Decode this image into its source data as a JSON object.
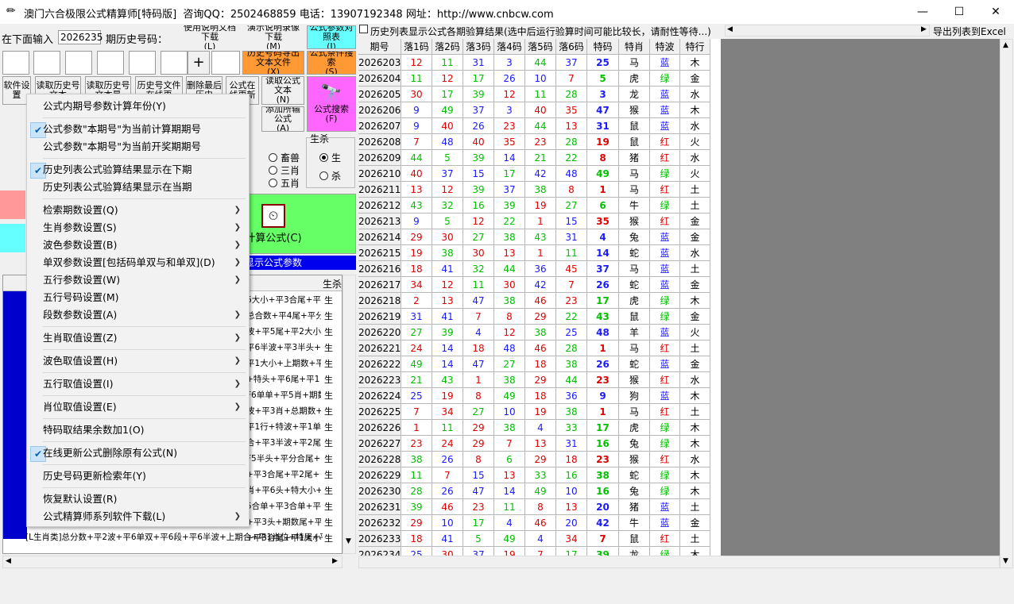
{
  "window": {
    "title": "澳门六合极限公式精算师[特码版]  咨询QQ：2502468859 电话：13907192348 网址：http://www.cnbcw.com",
    "minimize": "—",
    "maximize": "☐",
    "close": "✕"
  },
  "top": {
    "input_label": "在下面输入",
    "issue_value": "2026235",
    "history_label": "期历史号码：",
    "btn_manual": "使用说明文档下载",
    "btn_manual_key": "(L)",
    "btn_video": "演示说明录像下载",
    "btn_video_key": "(M)",
    "btn_params": "公式参数对照表",
    "btn_params_key": "(I)",
    "plus": "+"
  },
  "left_buttons": {
    "export_history": "历史号码导出文本文件",
    "export_history_key": "(X)",
    "condition_search": "公式条件搜索",
    "condition_search_key": "(S)",
    "read_formula": "读取公式文本",
    "read_formula_key": "(N)",
    "add_all": "添加所输公式",
    "add_all_key": "(A)",
    "formula_search": "公式搜索",
    "formula_search_key": "(F)",
    "calc_formula": "计算公式",
    "calc_formula_key": "(C)",
    "show_params": "显示公式参数",
    "row2": [
      "软件设置",
      "读取历史号文本",
      "读取历史号文本最",
      "历史号文件在线更",
      "删除最后历史",
      "公式在线更新"
    ]
  },
  "options": {
    "group_label": "生杀",
    "sheng": "生",
    "sha": "杀",
    "chusheng": "畜兽",
    "sanxiao": "三肖",
    "wuxiao": "五肖",
    "col_header": "生杀"
  },
  "formula_rows": [
    {
      "text": "6大小+平3合尾+平4",
      "s": "生"
    },
    {
      "text": "总合数+平4尾+平分",
      "s": "生"
    },
    {
      "text": "波+平5尾+平2大小",
      "s": "生"
    },
    {
      "text": "平6半波+平3半头+5",
      "s": "生"
    },
    {
      "text": "平1大小+上期数+平",
      "s": "生"
    },
    {
      "text": "+特头+平6尾+平1",
      "s": "生"
    },
    {
      "text": "F6单单+平5肖+期数",
      "s": "生"
    },
    {
      "text": "波+平3肖+总期数+",
      "s": "生"
    },
    {
      "text": "平1行+特波+平1单",
      "s": "生"
    },
    {
      "text": "合+平3半波+平2尾+",
      "s": "生"
    },
    {
      "text": "F5半头+平分合尾+平",
      "s": "生"
    },
    {
      "text": "+平3合尾+平2尾+",
      "s": "生"
    },
    {
      "text": "肖+平6头+特大小+",
      "s": "生"
    },
    {
      "text": "5合单+平3合单+平",
      "s": "生"
    },
    {
      "text": "+平3头+期数尾+平2",
      "s": "生"
    },
    {
      "text": "+平3合尾+平1大小",
      "s": "生"
    }
  ],
  "bottom_formula": "[L生肖类]总分数+平2波+平6单双+平6段+平6半波+上期合+平1肖位+特尾+平3合",
  "context_menu": [
    {
      "label": "公式内期号参数计算年份(Y)",
      "check": false,
      "sub": false,
      "sep_after": true
    },
    {
      "label": "公式参数\"本期号\"为当前计算期期号",
      "check": true,
      "sub": false,
      "sep_after": false
    },
    {
      "label": "公式参数\"本期号\"为当前开奖期期号",
      "check": false,
      "sub": false,
      "sep_after": true
    },
    {
      "label": "历史列表公式验算结果显示在下期",
      "check": true,
      "sub": false,
      "sep_after": false
    },
    {
      "label": "历史列表公式验算结果显示在当期",
      "check": false,
      "sub": false,
      "sep_after": true
    },
    {
      "label": "检索期数设置(Q)",
      "check": false,
      "sub": true,
      "sep_after": false
    },
    {
      "label": "生肖参数设置(S)",
      "check": false,
      "sub": true,
      "sep_after": false
    },
    {
      "label": "波色参数设置(B)",
      "check": false,
      "sub": true,
      "sep_after": false
    },
    {
      "label": "单双参数设置[包括码单双与和单双](D)",
      "check": false,
      "sub": true,
      "sep_after": false
    },
    {
      "label": "五行参数设置(W)",
      "check": false,
      "sub": true,
      "sep_after": false
    },
    {
      "label": "五行号码设置(M)",
      "check": false,
      "sub": false,
      "sep_after": false
    },
    {
      "label": "段数参数设置(A)",
      "check": false,
      "sub": true,
      "sep_after": true
    },
    {
      "label": "生肖取值设置(Z)",
      "check": false,
      "sub": true,
      "sep_after": true
    },
    {
      "label": "波色取值设置(H)",
      "check": false,
      "sub": true,
      "sep_after": true
    },
    {
      "label": "五行取值设置(I)",
      "check": false,
      "sub": true,
      "sep_after": true
    },
    {
      "label": "肖位取值设置(E)",
      "check": false,
      "sub": true,
      "sep_after": true
    },
    {
      "label": "特码取结果余数加1(O)",
      "check": false,
      "sub": false,
      "sep_after": true
    },
    {
      "label": "在线更新公式删除原有公式(N)",
      "check": true,
      "sub": false,
      "sep_after": true
    },
    {
      "label": "历史号码更新检索年(Y)",
      "check": false,
      "sub": false,
      "sep_after": true
    },
    {
      "label": "恢复默认设置(R)",
      "check": false,
      "sub": false,
      "sep_after": false
    },
    {
      "label": "公式精算师系列软件下载(L)",
      "check": false,
      "sub": true,
      "sep_after": false
    }
  ],
  "right_header": {
    "checkbox_label": "历史列表显示公式各期验算结果(选中后运行验算时间可能比较长，请耐性等待...)",
    "export_excel": "导出列表到Excel"
  },
  "table": {
    "columns": [
      "期号",
      "落1码",
      "落2码",
      "落3码",
      "落4码",
      "落5码",
      "落6码",
      "特码",
      "特肖",
      "特波",
      "特行"
    ],
    "colors": {
      "red": "#e00000",
      "blue": "#1a1aff",
      "green": "#00c000"
    },
    "rows": [
      [
        "2026203",
        "12",
        "11",
        "31",
        "3",
        "44",
        "37",
        "25",
        "马",
        "蓝",
        "木"
      ],
      [
        "2026204",
        "11",
        "12",
        "17",
        "26",
        "10",
        "7",
        "5",
        "虎",
        "绿",
        "金"
      ],
      [
        "2026205",
        "30",
        "17",
        "39",
        "12",
        "11",
        "28",
        "3",
        "龙",
        "蓝",
        "水"
      ],
      [
        "2026206",
        "9",
        "49",
        "37",
        "3",
        "40",
        "35",
        "47",
        "猴",
        "蓝",
        "木"
      ],
      [
        "2026207",
        "9",
        "40",
        "26",
        "23",
        "44",
        "13",
        "31",
        "鼠",
        "蓝",
        "水"
      ],
      [
        "2026208",
        "7",
        "48",
        "40",
        "35",
        "23",
        "28",
        "19",
        "鼠",
        "红",
        "火"
      ],
      [
        "2026209",
        "44",
        "5",
        "39",
        "14",
        "21",
        "22",
        "8",
        "猪",
        "红",
        "水"
      ],
      [
        "2026210",
        "40",
        "37",
        "15",
        "17",
        "42",
        "48",
        "49",
        "马",
        "绿",
        "火"
      ],
      [
        "2026211",
        "13",
        "12",
        "39",
        "37",
        "38",
        "8",
        "1",
        "马",
        "红",
        "土"
      ],
      [
        "2026212",
        "43",
        "32",
        "16",
        "39",
        "19",
        "27",
        "6",
        "牛",
        "绿",
        "土"
      ],
      [
        "2026213",
        "9",
        "5",
        "12",
        "22",
        "1",
        "15",
        "35",
        "猴",
        "红",
        "金"
      ],
      [
        "2026214",
        "29",
        "30",
        "27",
        "38",
        "43",
        "31",
        "4",
        "兔",
        "蓝",
        "金"
      ],
      [
        "2026215",
        "19",
        "38",
        "30",
        "13",
        "1",
        "11",
        "14",
        "蛇",
        "蓝",
        "水"
      ],
      [
        "2026216",
        "18",
        "41",
        "32",
        "44",
        "36",
        "45",
        "37",
        "马",
        "蓝",
        "土"
      ],
      [
        "2026217",
        "34",
        "12",
        "11",
        "30",
        "42",
        "7",
        "26",
        "蛇",
        "蓝",
        "金"
      ],
      [
        "2026218",
        "2",
        "13",
        "47",
        "38",
        "46",
        "23",
        "17",
        "虎",
        "绿",
        "木"
      ],
      [
        "2026219",
        "31",
        "41",
        "7",
        "8",
        "29",
        "22",
        "43",
        "鼠",
        "绿",
        "金"
      ],
      [
        "2026220",
        "27",
        "39",
        "4",
        "12",
        "38",
        "25",
        "48",
        "羊",
        "蓝",
        "火"
      ],
      [
        "2026221",
        "24",
        "14",
        "18",
        "48",
        "46",
        "28",
        "1",
        "马",
        "红",
        "土"
      ],
      [
        "2026222",
        "49",
        "14",
        "47",
        "27",
        "18",
        "38",
        "26",
        "蛇",
        "蓝",
        "金"
      ],
      [
        "2026223",
        "21",
        "43",
        "1",
        "38",
        "29",
        "44",
        "23",
        "猴",
        "红",
        "水"
      ],
      [
        "2026224",
        "25",
        "19",
        "8",
        "49",
        "18",
        "36",
        "9",
        "狗",
        "蓝",
        "木"
      ],
      [
        "2026225",
        "7",
        "34",
        "27",
        "10",
        "19",
        "38",
        "1",
        "马",
        "红",
        "土"
      ],
      [
        "2026226",
        "1",
        "11",
        "29",
        "38",
        "4",
        "33",
        "17",
        "虎",
        "绿",
        "木"
      ],
      [
        "2026227",
        "23",
        "24",
        "29",
        "7",
        "13",
        "31",
        "16",
        "兔",
        "绿",
        "木"
      ],
      [
        "2026228",
        "38",
        "26",
        "8",
        "6",
        "29",
        "18",
        "23",
        "猴",
        "红",
        "水"
      ],
      [
        "2026229",
        "11",
        "7",
        "15",
        "13",
        "33",
        "16",
        "38",
        "蛇",
        "绿",
        "木"
      ],
      [
        "2026230",
        "28",
        "26",
        "47",
        "14",
        "49",
        "10",
        "16",
        "兔",
        "绿",
        "木"
      ],
      [
        "2026231",
        "39",
        "46",
        "23",
        "11",
        "8",
        "13",
        "20",
        "猪",
        "蓝",
        "土"
      ],
      [
        "2026232",
        "29",
        "10",
        "17",
        "4",
        "46",
        "20",
        "42",
        "牛",
        "蓝",
        "金"
      ],
      [
        "2026233",
        "18",
        "41",
        "5",
        "49",
        "4",
        "34",
        "7",
        "鼠",
        "红",
        "土"
      ],
      [
        "2026234",
        "25",
        "30",
        "37",
        "19",
        "7",
        "17",
        "39",
        "龙",
        "绿",
        "木"
      ]
    ]
  }
}
